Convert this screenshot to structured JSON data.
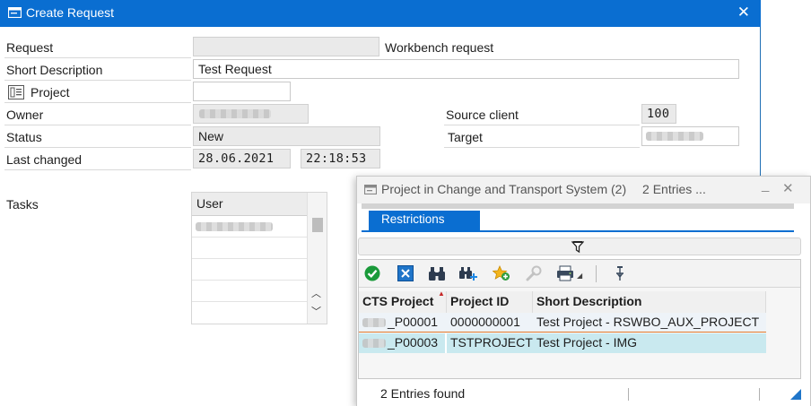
{
  "main": {
    "title": "Create Request",
    "labels": {
      "request": "Request",
      "short_description": "Short Description",
      "project": "Project",
      "owner": "Owner",
      "status": "Status",
      "last_changed": "Last changed",
      "tasks": "Tasks",
      "source_client": "Source client",
      "target": "Target"
    },
    "values": {
      "request_type": "Workbench request",
      "short_description": "Test Request",
      "status": "New",
      "date": "28.06.2021",
      "time": "22:18:53",
      "source_client": "100"
    },
    "tasks_table": {
      "header": "User"
    }
  },
  "popup": {
    "title": "Project in Change and Transport System (2)",
    "entries": "2 Entries ...",
    "tab": "Restrictions",
    "columns": [
      "CTS Project",
      "Project ID",
      "Short Description"
    ],
    "rows": [
      {
        "cts_project": "_P00001",
        "project_id": "0000000001",
        "short_description": "Test Project - RSWBO_AUX_PROJECT"
      },
      {
        "cts_project": "_P00003",
        "project_id": "TSTPROJECT",
        "short_description": "Test Project - IMG"
      }
    ],
    "status": "2 Entries found"
  },
  "colors": {
    "title_bar": "#0a6ed1",
    "selected_row": "#c9e9ef",
    "accent": "#0a6ed1"
  },
  "icons": [
    "window-icon",
    "close-icon",
    "project-icon",
    "check-icon",
    "cancel-icon",
    "binoculars-icon",
    "binoculars-plus-icon",
    "favorite-add-icon",
    "wrench-icon",
    "print-icon",
    "filter-icon",
    "funnel-icon",
    "minimize-icon",
    "resize-grip-icon"
  ]
}
